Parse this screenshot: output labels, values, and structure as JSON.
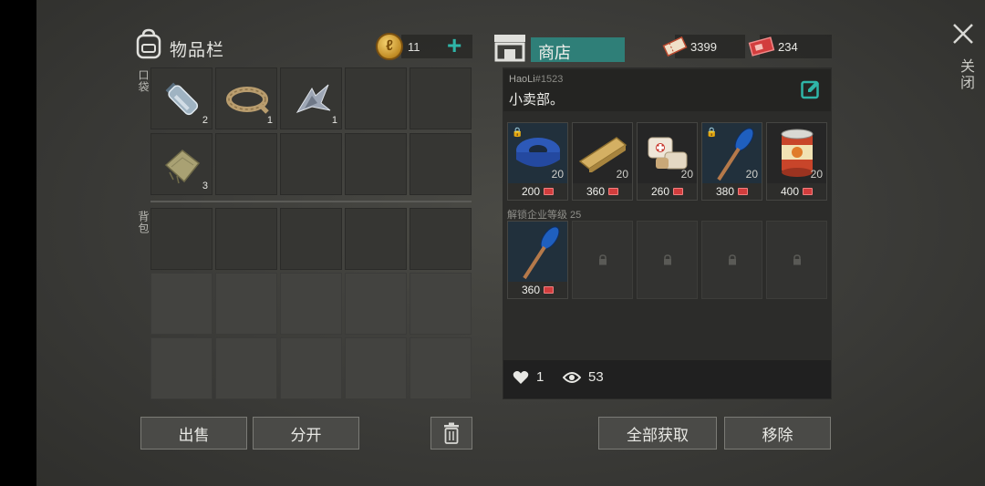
{
  "inventory": {
    "title": "物品栏",
    "coins": "11",
    "pocket_label": "口袋",
    "backpack_label": "背包",
    "pocket_items": [
      {
        "name": "water-bottle",
        "qty": "2"
      },
      {
        "name": "rope",
        "qty": "1"
      },
      {
        "name": "scrap-metal",
        "qty": "1"
      },
      {
        "name": "cloth",
        "qty": "3"
      }
    ]
  },
  "buttons": {
    "sell": "出售",
    "split": "分开",
    "take_all": "全部获取",
    "remove": "移除"
  },
  "shop": {
    "title": "商店",
    "currency_a": "3399",
    "currency_b": "234",
    "owner_name": "HaoLi",
    "owner_id": "#1523",
    "message": "小卖部。",
    "unlock_label": "解锁企业等级 25",
    "likes": "1",
    "views": "53",
    "items": [
      {
        "name": "duct-tape",
        "stock": "20",
        "price": "200",
        "locked": true
      },
      {
        "name": "wood-plank",
        "stock": "20",
        "price": "360",
        "locked": false
      },
      {
        "name": "bandage",
        "stock": "20",
        "price": "260",
        "locked": false
      },
      {
        "name": "oar",
        "stock": "20",
        "price": "380",
        "locked": true
      },
      {
        "name": "canned-food",
        "stock": "20",
        "price": "400",
        "locked": false
      }
    ],
    "level_item": {
      "name": "oar",
      "price": "360"
    }
  },
  "close_label": "关闭",
  "colors": {
    "accent": "#2f7f78",
    "plus": "#2fb5a8",
    "ticket": "#d23d3d"
  }
}
